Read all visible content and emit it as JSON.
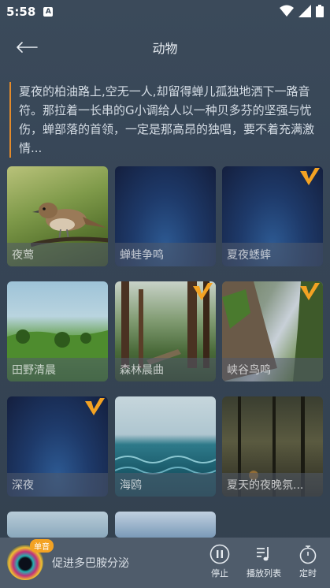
{
  "status": {
    "time": "5:58",
    "sim_label": "A"
  },
  "header": {
    "title": "动物"
  },
  "description": "夏夜的柏油路上,空无一人,却留得蝉儿孤独地洒下一路音符。那拉着一长串的G小调给人以一种贝多芬的坚强与忧伤，蝉部落的首领，一定是那高昂的独唱，要不着充满激情...",
  "tiles": [
    {
      "label": "夜莺",
      "vip": false
    },
    {
      "label": "蝉蛙争鸣",
      "vip": false
    },
    {
      "label": "夏夜蟋蟀",
      "vip": true
    },
    {
      "label": "田野清晨",
      "vip": false
    },
    {
      "label": "森林晨曲",
      "vip": true
    },
    {
      "label": "峡谷鸟鸣",
      "vip": true
    },
    {
      "label": "深夜",
      "vip": true
    },
    {
      "label": "海鸥",
      "vip": false
    },
    {
      "label": "夏天的夜晚氛...",
      "vip": false
    }
  ],
  "player": {
    "badge": "单音",
    "track": "促进多巴胺分泌",
    "controls": {
      "stop": "停止",
      "playlist": "播放列表",
      "timer": "定时"
    }
  },
  "colors": {
    "accent": "#e38b2b",
    "vip_badge": "#f3a223"
  },
  "icons": [
    "back-arrow-icon",
    "wifi-icon",
    "signal-icon",
    "battery-icon",
    "pause-icon",
    "playlist-icon",
    "timer-icon",
    "vip-badge-icon"
  ]
}
